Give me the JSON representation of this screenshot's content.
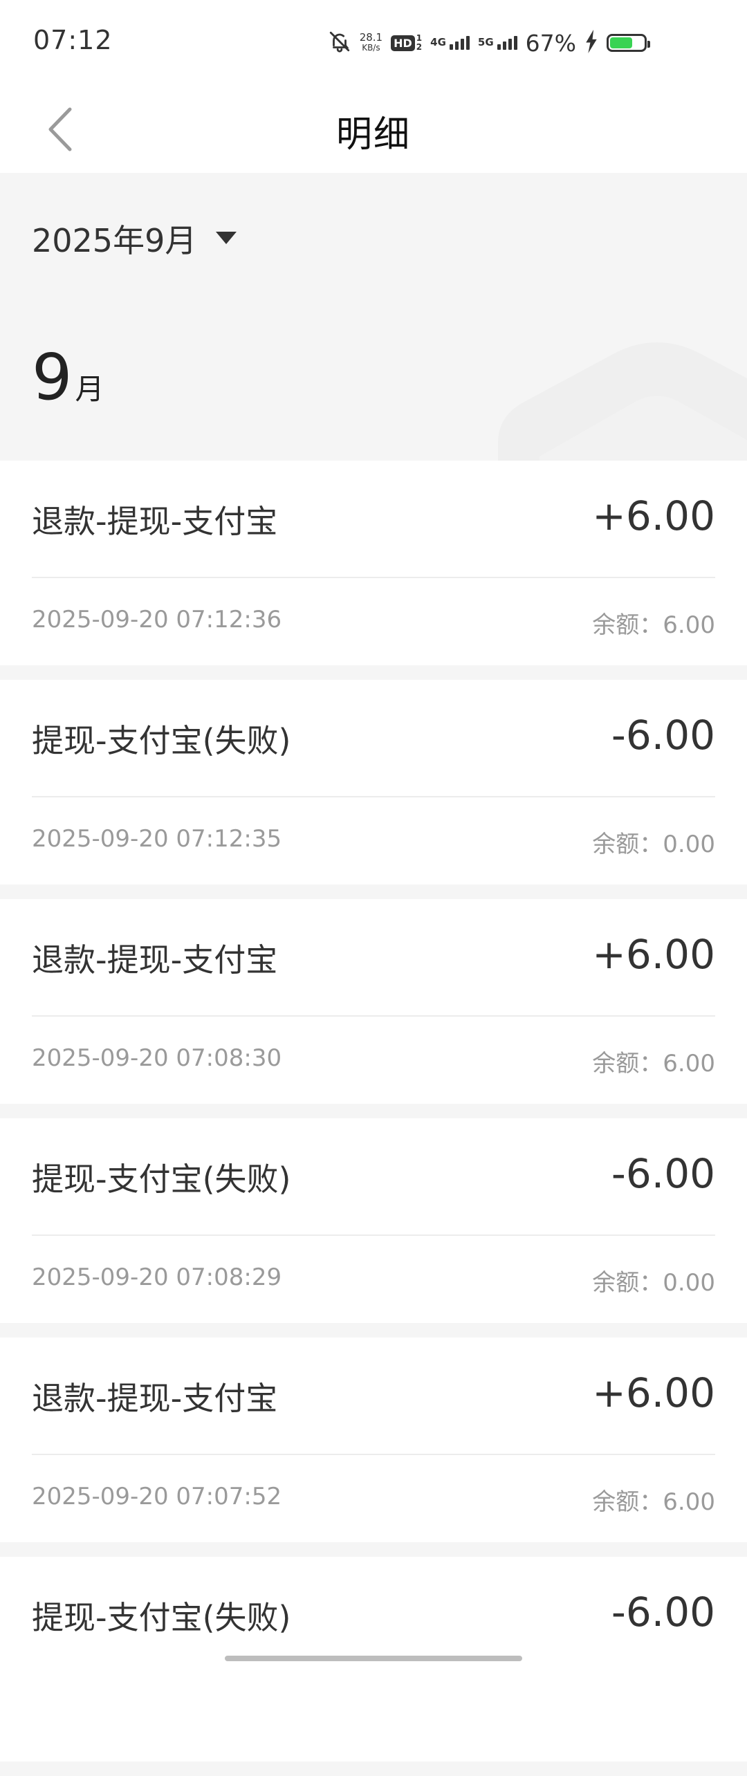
{
  "status_bar": {
    "time": "07:12",
    "net_speed_value": "28.1",
    "net_speed_unit": "KB/s",
    "hd_label": "HD",
    "hd_sub_top": "1",
    "hd_sub_bottom": "2",
    "net1_label": "4G",
    "net2_label": "5G",
    "battery_pct": "67%",
    "battery_level": 0.67,
    "icons": [
      "bell-muted-icon",
      "hd-icon",
      "signal-4g-icon",
      "signal-5g-icon",
      "charging-icon",
      "battery-icon"
    ]
  },
  "header": {
    "title": "明细",
    "back_icon": "chevron-left-icon"
  },
  "month_header": {
    "picker_label": "2025年9月",
    "picker_icon": "triangle-down-icon",
    "month_number": "9",
    "month_unit": "月"
  },
  "transactions": [
    {
      "title": "退款-提现-支付宝",
      "amount": "+6.00",
      "time": "2025-09-20 07:12:36",
      "balance": "余额：6.00"
    },
    {
      "title": "提现-支付宝(失败)",
      "amount": "-6.00",
      "time": "2025-09-20 07:12:35",
      "balance": "余额：0.00"
    },
    {
      "title": "退款-提现-支付宝",
      "amount": "+6.00",
      "time": "2025-09-20 07:08:30",
      "balance": "余额：6.00"
    },
    {
      "title": "提现-支付宝(失败)",
      "amount": "-6.00",
      "time": "2025-09-20 07:08:29",
      "balance": "余额：0.00"
    },
    {
      "title": "退款-提现-支付宝",
      "amount": "+6.00",
      "time": "2025-09-20 07:07:52",
      "balance": "余额：6.00"
    },
    {
      "title": "提现-支付宝(失败)",
      "amount": "-6.00",
      "time": "",
      "balance": ""
    }
  ],
  "colors": {
    "text_primary": "#333333",
    "text_secondary": "#9a9a9a",
    "background_gray": "#f5f5f5",
    "battery_green": "#39d353"
  }
}
